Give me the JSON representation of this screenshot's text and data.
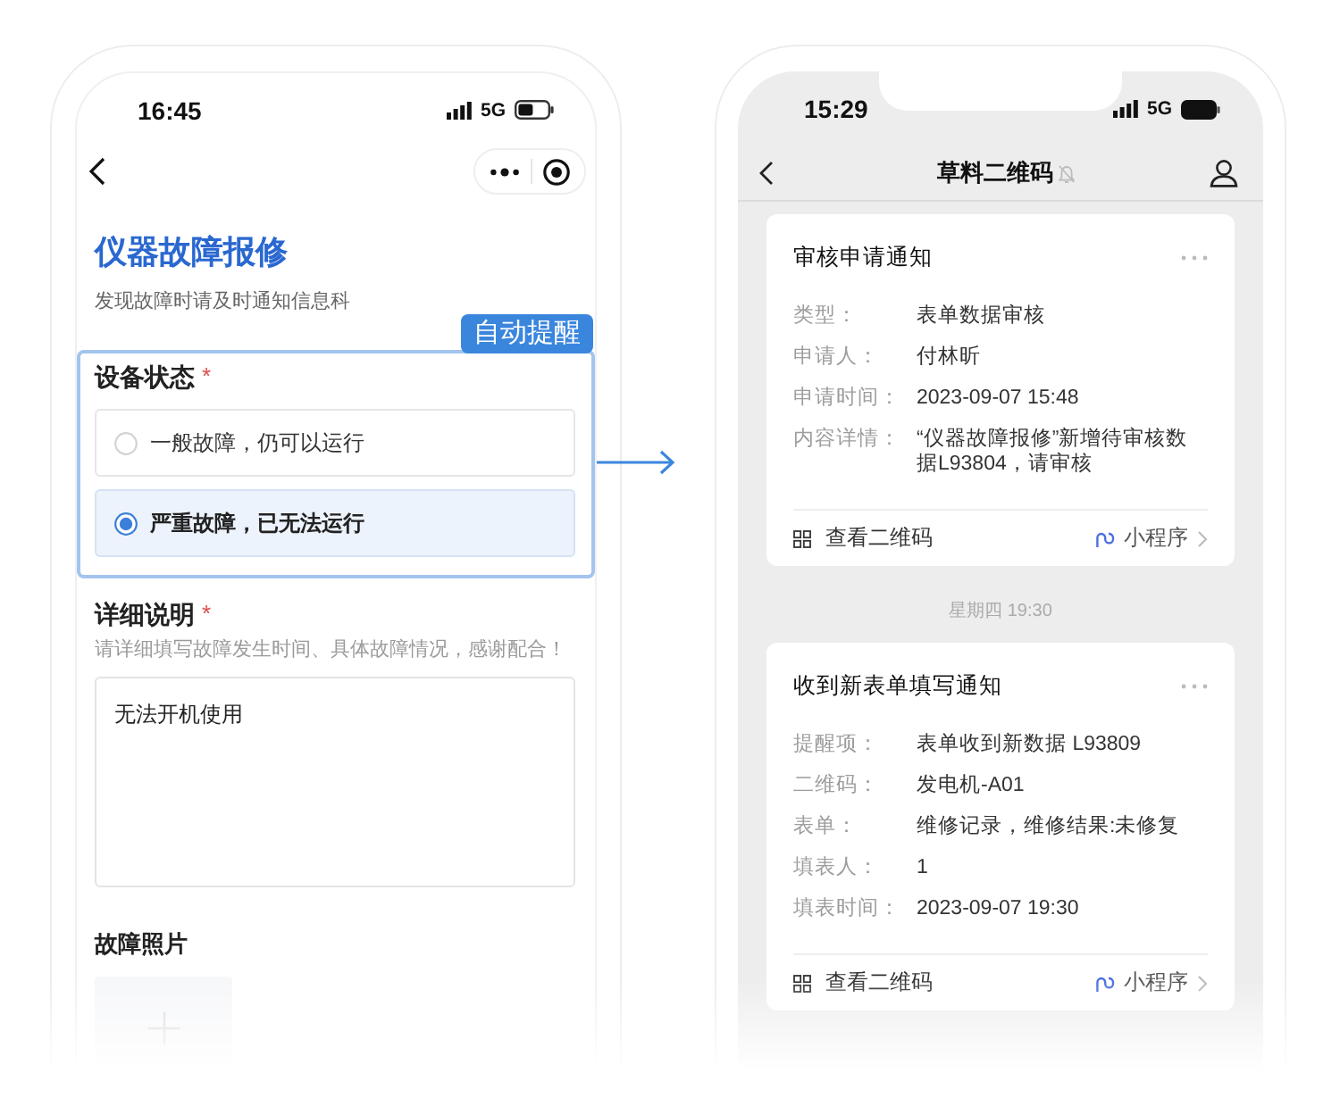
{
  "form_phone": {
    "status_bar": {
      "time": "16:45",
      "network": "5G"
    },
    "title": "仪器故障报修",
    "subtitle": "发现故障时请及时通知信息科",
    "badge": "自动提醒",
    "device_status": {
      "label": "设备状态",
      "required_mark": "*",
      "options": [
        {
          "label": "一般故障，仍可以运行",
          "selected": false
        },
        {
          "label": "严重故障，已无法运行",
          "selected": true
        }
      ]
    },
    "details": {
      "label": "详细说明",
      "required_mark": "*",
      "hint": "请详细填写故障发生时间、具体故障情况，感谢配合！",
      "value": "无法开机使用"
    },
    "photos": {
      "label": "故障照片"
    }
  },
  "chat_phone": {
    "status_bar": {
      "time": "15:29",
      "network": "5G"
    },
    "title": "草料二维码",
    "messages": [
      {
        "kind": "card",
        "title": "审核申请通知",
        "fields": [
          {
            "label": "类型：",
            "value": "表单数据审核"
          },
          {
            "label": "申请人：",
            "value": "付林昕"
          },
          {
            "label": "申请时间：",
            "value": "2023-09-07 15:48"
          },
          {
            "label": "内容详情：",
            "value": "“仪器故障报修”新增待审核数据L93804，请审核"
          }
        ],
        "footer": {
          "qr_link": "查看二维码",
          "app_link": "小程序"
        }
      },
      {
        "kind": "time",
        "text": "星期四 19:30"
      },
      {
        "kind": "card",
        "title": "收到新表单填写通知",
        "fields": [
          {
            "label": "提醒项：",
            "value": "表单收到新数据 L93809"
          },
          {
            "label": "二维码：",
            "value": "发电机-A01"
          },
          {
            "label": "表单：",
            "value": "维修记录，维修结果:未修复"
          },
          {
            "label": "填表人：",
            "value": "1"
          },
          {
            "label": "填表时间：",
            "value": "2023-09-07 19:30"
          }
        ],
        "footer": {
          "qr_link": "查看二维码",
          "app_link": "小程序"
        }
      }
    ]
  }
}
